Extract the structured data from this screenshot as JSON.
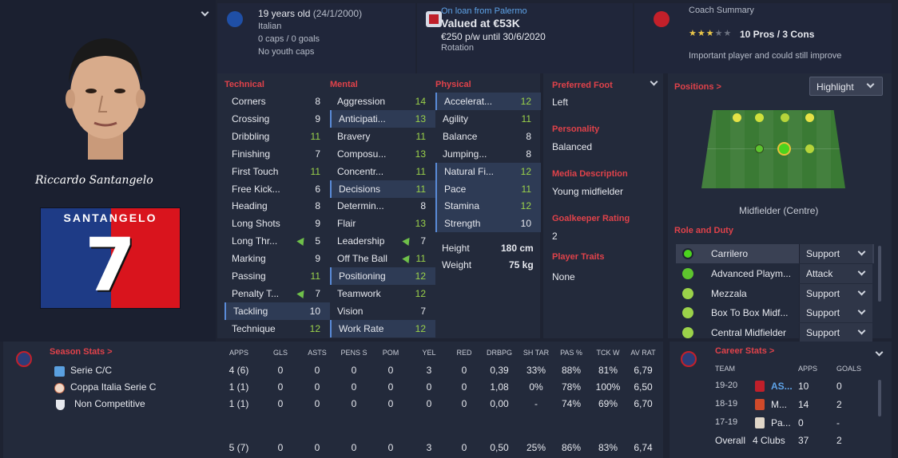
{
  "player": {
    "age_line": "19 years old",
    "dob": "(24/1/2000)",
    "nationality": "Italian",
    "caps": "0 caps / 0 goals",
    "youth_caps": "No youth caps",
    "signature": "Riccardo Santangelo",
    "shirt_name": "SANTANGELO",
    "shirt_number": "7"
  },
  "contract": {
    "loan": "On loan from Palermo",
    "value": "Valued at €53K",
    "wage": "€250 p/w until 30/6/2020",
    "status": "Rotation"
  },
  "coach": {
    "title": "Coach Summary",
    "stars_filled": 3,
    "stars_total": 5,
    "pros_cons": "10 Pros / 3 Cons",
    "summary": "Important player and could still improve"
  },
  "attributes": {
    "technical": {
      "title": "Technical",
      "rows": [
        {
          "name": "Corners",
          "value": "8"
        },
        {
          "name": "Crossing",
          "value": "9"
        },
        {
          "name": "Dribbling",
          "value": "11"
        },
        {
          "name": "Finishing",
          "value": "7"
        },
        {
          "name": "First Touch",
          "value": "11"
        },
        {
          "name": "Free Kick...",
          "value": "6"
        },
        {
          "name": "Heading",
          "value": "8"
        },
        {
          "name": "Long Shots",
          "value": "9"
        },
        {
          "name": "Long Thr...",
          "value": "5"
        },
        {
          "name": "Marking",
          "value": "9"
        },
        {
          "name": "Passing",
          "value": "11"
        },
        {
          "name": "Penalty T...",
          "value": "7"
        },
        {
          "name": "Tackling",
          "value": "10"
        },
        {
          "name": "Technique",
          "value": "12"
        }
      ]
    },
    "mental": {
      "title": "Mental",
      "rows": [
        {
          "name": "Aggression",
          "value": "14"
        },
        {
          "name": "Anticipati...",
          "value": "13"
        },
        {
          "name": "Bravery",
          "value": "11"
        },
        {
          "name": "Composu...",
          "value": "13"
        },
        {
          "name": "Concentr...",
          "value": "11"
        },
        {
          "name": "Decisions",
          "value": "11"
        },
        {
          "name": "Determin...",
          "value": "8"
        },
        {
          "name": "Flair",
          "value": "13"
        },
        {
          "name": "Leadership",
          "value": "7"
        },
        {
          "name": "Off The Ball",
          "value": "11"
        },
        {
          "name": "Positioning",
          "value": "12"
        },
        {
          "name": "Teamwork",
          "value": "12"
        },
        {
          "name": "Vision",
          "value": "7"
        },
        {
          "name": "Work Rate",
          "value": "12"
        }
      ]
    },
    "physical": {
      "title": "Physical",
      "rows": [
        {
          "name": "Accelerat...",
          "value": "12"
        },
        {
          "name": "Agility",
          "value": "11"
        },
        {
          "name": "Balance",
          "value": "8"
        },
        {
          "name": "Jumping...",
          "value": "8"
        },
        {
          "name": "Natural Fi...",
          "value": "12"
        },
        {
          "name": "Pace",
          "value": "11"
        },
        {
          "name": "Stamina",
          "value": "12"
        },
        {
          "name": "Strength",
          "value": "10"
        }
      ],
      "height_label": "Height",
      "height": "180 cm",
      "weight_label": "Weight",
      "weight": "75 kg"
    }
  },
  "details": {
    "foot_label": "Preferred Foot",
    "foot": "Left",
    "personality_label": "Personality",
    "personality": "Balanced",
    "media_label": "Media Description",
    "media": "Young midfielder",
    "gk_label": "Goalkeeper Rating",
    "gk": "2",
    "traits_label": "Player Traits",
    "traits": "None"
  },
  "positions": {
    "title": "Positions >",
    "highlight": "Highlight",
    "caption": "Midfielder (Centre)"
  },
  "roles": {
    "title": "Role and Duty",
    "rows": [
      {
        "role": "Carrilero",
        "duty": "Support"
      },
      {
        "role": "Advanced Playm...",
        "duty": "Attack"
      },
      {
        "role": "Mezzala",
        "duty": "Support"
      },
      {
        "role": "Box To Box Midf...",
        "duty": "Support"
      },
      {
        "role": "Central Midfielder",
        "duty": "Support"
      }
    ]
  },
  "season_stats": {
    "title": "Season Stats >",
    "headers": [
      "APPS",
      "GLS",
      "ASTS",
      "PENS S",
      "POM",
      "YEL",
      "RED",
      "DRBPG",
      "SH TAR",
      "PAS %",
      "TCK W",
      "AV RAT"
    ],
    "rows": [
      {
        "comp": "Serie C/C",
        "cells": [
          "4 (6)",
          "0",
          "0",
          "0",
          "0",
          "3",
          "0",
          "0,39",
          "33%",
          "88%",
          "81%",
          "6,79"
        ]
      },
      {
        "comp": "Coppa Italia Serie C",
        "cells": [
          "1 (1)",
          "0",
          "0",
          "0",
          "0",
          "0",
          "0",
          "1,08",
          "0%",
          "78%",
          "100%",
          "6,50"
        ]
      },
      {
        "comp": "Non Competitive",
        "cells": [
          "1 (1)",
          "0",
          "0",
          "0",
          "0",
          "0",
          "0",
          "0,00",
          "-",
          "74%",
          "69%",
          "6,70"
        ]
      }
    ],
    "totals": [
      "5 (7)",
      "0",
      "0",
      "0",
      "0",
      "3",
      "0",
      "0,50",
      "25%",
      "86%",
      "83%",
      "6,74"
    ]
  },
  "career_stats": {
    "title": "Career Stats >",
    "headers": [
      "TEAM",
      "APPS",
      "GOALS"
    ],
    "rows": [
      {
        "season": "19-20",
        "team": "AS...",
        "apps": "10",
        "goals": "0"
      },
      {
        "season": "18-19",
        "team": "M...",
        "apps": "14",
        "goals": "2"
      },
      {
        "season": "17-19",
        "team": "Pa...",
        "apps": "0",
        "goals": "-"
      }
    ],
    "overall_label": "Overall",
    "overall_team": "4 Clubs",
    "overall_apps": "37",
    "overall_goals": "2"
  },
  "colors": {
    "accent_red": "#e0424a",
    "good_green": "#9bd24a",
    "background": "#1e2332"
  }
}
